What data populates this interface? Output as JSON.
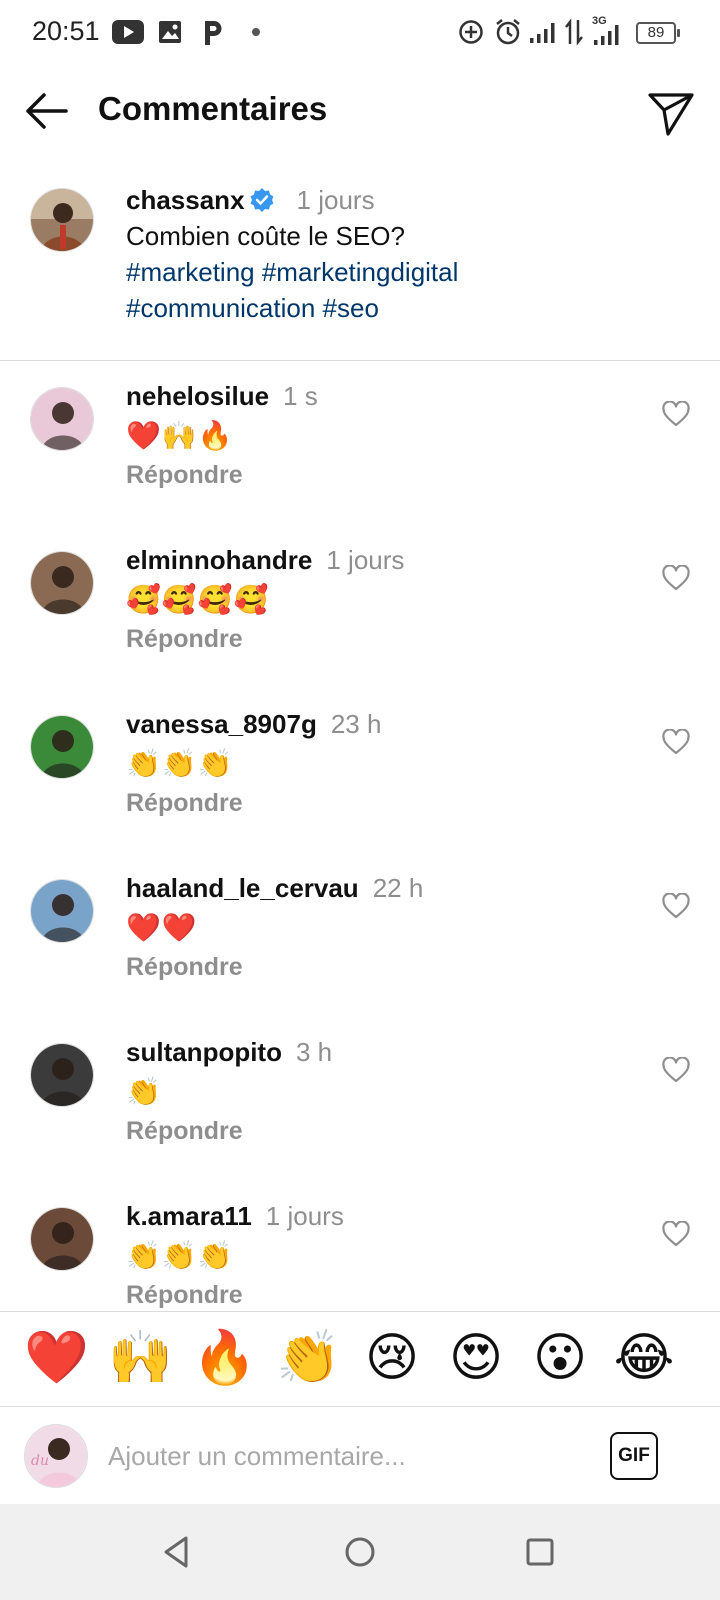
{
  "status_bar": {
    "time": "20:51",
    "battery": "89",
    "network": "3G",
    "icons": [
      "youtube-icon",
      "gallery-icon",
      "p-app-icon",
      "dot-icon",
      "data-saver-icon",
      "alarm-icon",
      "signal-icon",
      "data-arrows-icon",
      "signal-3g-icon",
      "battery-icon"
    ]
  },
  "header": {
    "title": "Commentaires",
    "back_icon": "back-arrow-icon",
    "share_icon": "send-icon"
  },
  "caption": {
    "username": "chassanx",
    "verified": true,
    "timestamp": "1 jours",
    "text": "Combien coûte le SEO?",
    "hashtags_line1": "#marketing #marketingdigital",
    "hashtags_line2": "#communication #seo"
  },
  "comments": [
    {
      "username": "nehelosilue",
      "timestamp": "1 s",
      "text": "❤️🙌🔥",
      "reply_label": "Répondre",
      "avatar_color": "#e9c9d8"
    },
    {
      "username": "elminnohandre",
      "timestamp": "1 jours",
      "text": "🥰🥰🥰🥰",
      "reply_label": "Répondre",
      "avatar_color": "#8a6a52"
    },
    {
      "username": "vanessa_8907g",
      "timestamp": "23 h",
      "text": "👏👏👏",
      "reply_label": "Répondre",
      "avatar_color": "#3a8a3a"
    },
    {
      "username": "haaland_le_cervau",
      "timestamp": "22 h",
      "text": "❤️❤️",
      "reply_label": "Répondre",
      "avatar_color": "#7aa3c9"
    },
    {
      "username": "sultanpopito",
      "timestamp": "3 h",
      "text": "👏",
      "reply_label": "Répondre",
      "avatar_color": "#3b3b3b"
    },
    {
      "username": "k.amara11",
      "timestamp": "1 jours",
      "text": "👏👏👏",
      "reply_label": "Répondre",
      "avatar_color": "#6b4a3a"
    }
  ],
  "emoji_bar": [
    "❤️",
    "🙌",
    "🔥",
    "👏",
    "😢",
    "😍",
    "😮",
    "😂"
  ],
  "input": {
    "placeholder": "Ajouter un commentaire...",
    "gif_label": "GIF"
  },
  "nav": {
    "icons": [
      "nav-back-icon",
      "nav-home-icon",
      "nav-recents-icon"
    ]
  }
}
